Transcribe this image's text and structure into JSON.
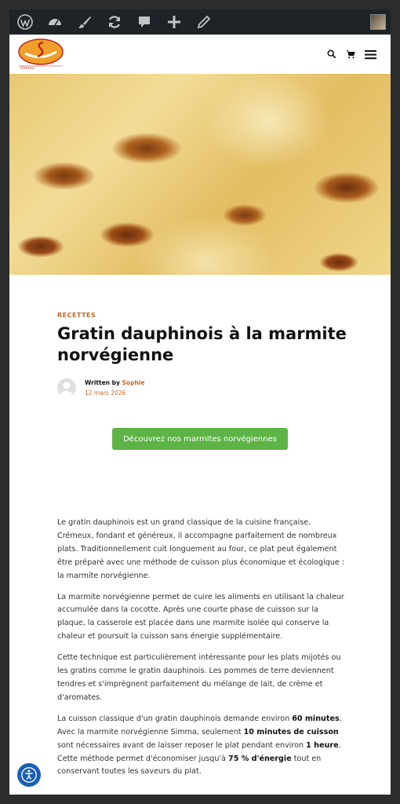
{
  "admin_bar": {
    "items": [
      "wordpress-icon",
      "dashboard-icon",
      "customize-icon",
      "updates-icon",
      "comments-icon",
      "new-icon",
      "edit-icon"
    ]
  },
  "header": {
    "logo_text": "Simma",
    "icons": [
      "search-icon",
      "cart-icon",
      "menu-icon"
    ]
  },
  "article": {
    "category": "RECETTES",
    "title": "Gratin dauphinois à la marmite norvégienne",
    "byline_prefix": "Written by",
    "author": "Sophie",
    "date": "12 mars 2026",
    "cta_label": "Découvrez nos marmites norvégiennes",
    "paragraphs": [
      "Le gratin dauphinois est un grand classique de la cuisine française. Crémeux, fondant et généreux, il accompagne parfaitement de nombreux plats. Traditionnellement cuit longuement au four, ce plat peut également être préparé avec une méthode de cuisson plus économique et écologique : la marmite norvégienne.",
      "La marmite norvégienne permet de cuire les aliments en utilisant la chaleur accumulée dans la cocotte. Après une courte phase de cuisson sur la plaque, la casserole est placée dans une marmite isolée qui conserve la chaleur et poursuit la cuisson sans énergie supplémentaire.",
      "Cette technique est particulièrement intéressante pour les plats mijotés ou les gratins comme le gratin dauphinois. Les pommes de terre deviennent tendres et s'imprègnent parfaitement du mélange de lait, de crème et d'aromates."
    ],
    "p4": {
      "t1": "La cuisson classique d'un gratin dauphinois demande environ ",
      "b1": "60 minutes",
      "t2": ". Avec la marmite norvégienne Simma, seulement ",
      "b2": "10 minutes de cuisson",
      "t3": " sont nécessaires avant de laisser reposer le plat pendant environ ",
      "b3": "1 heure",
      "t4": ". Cette méthode permet d'économiser jusqu'à ",
      "b4": "75 % d'énergie",
      "t5": " tout en conservant toutes les saveurs du plat."
    }
  },
  "colors": {
    "admin_bar": "#1d2327",
    "accent": "#c0692a",
    "cta": "#5db346",
    "a11y": "#1a5fb4"
  }
}
